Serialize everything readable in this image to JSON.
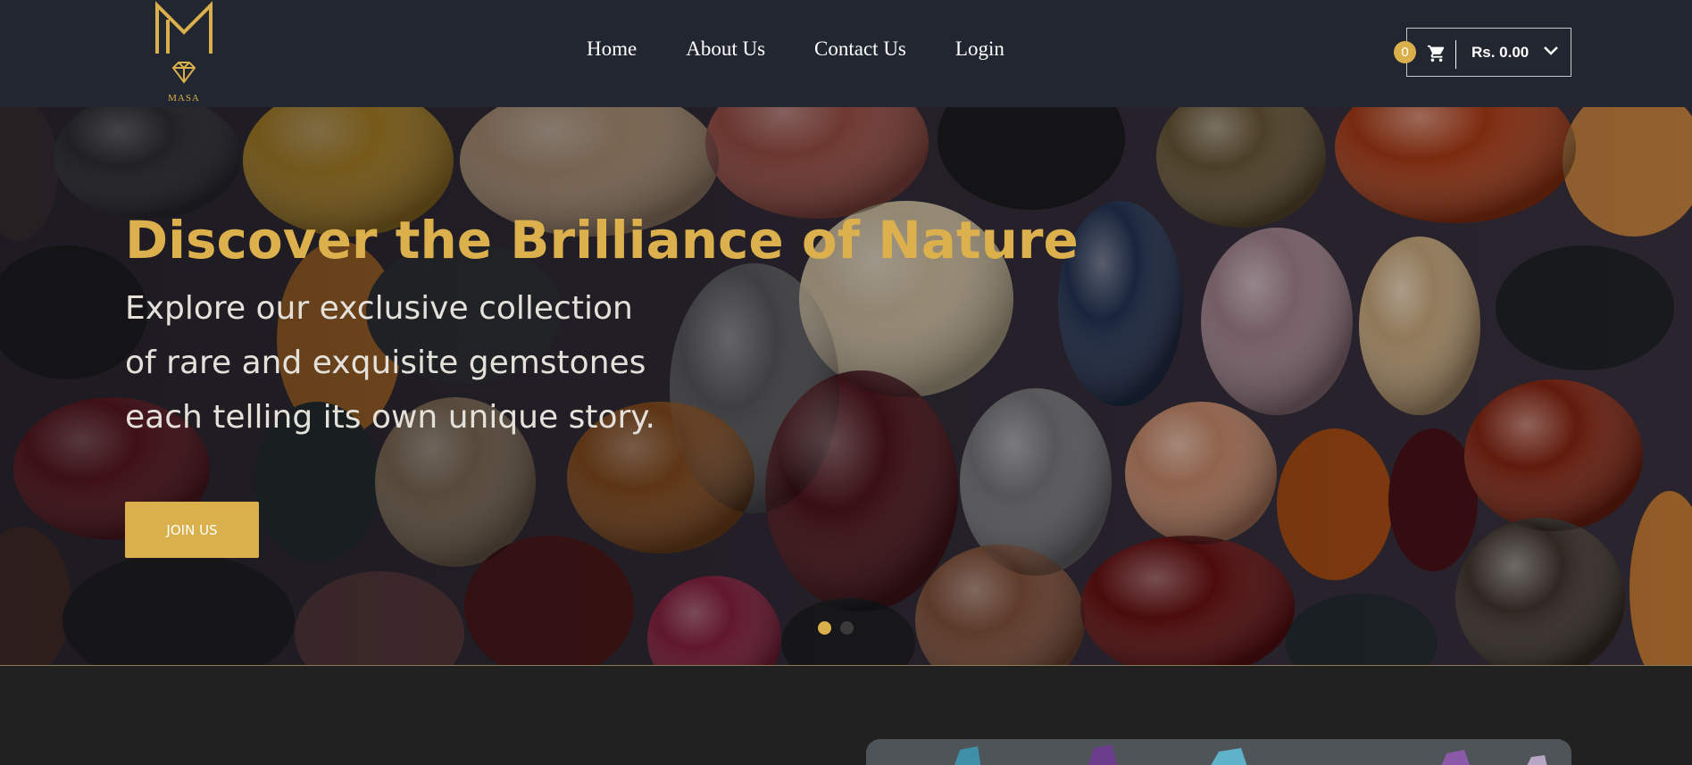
{
  "brand": {
    "logo_text": "MASA"
  },
  "nav": {
    "items": [
      "Home",
      "About Us",
      "Contact Us",
      "Login"
    ]
  },
  "cart": {
    "count": "0",
    "total": "Rs. 0.00",
    "icon": "cart-icon",
    "dropdown_icon": "chevron-down-icon"
  },
  "hero": {
    "title": "Discover the Brilliance of Nature",
    "subtitle_lines": [
      "Explore our exclusive collection",
      "of rare and exquisite gemstones",
      "each telling its own unique story."
    ],
    "button_label": "JOIN US",
    "slides": 2,
    "active_slide": 1
  },
  "colors": {
    "accent": "#d9b04c",
    "header_bg": "#212630",
    "page_bg": "#212121"
  }
}
